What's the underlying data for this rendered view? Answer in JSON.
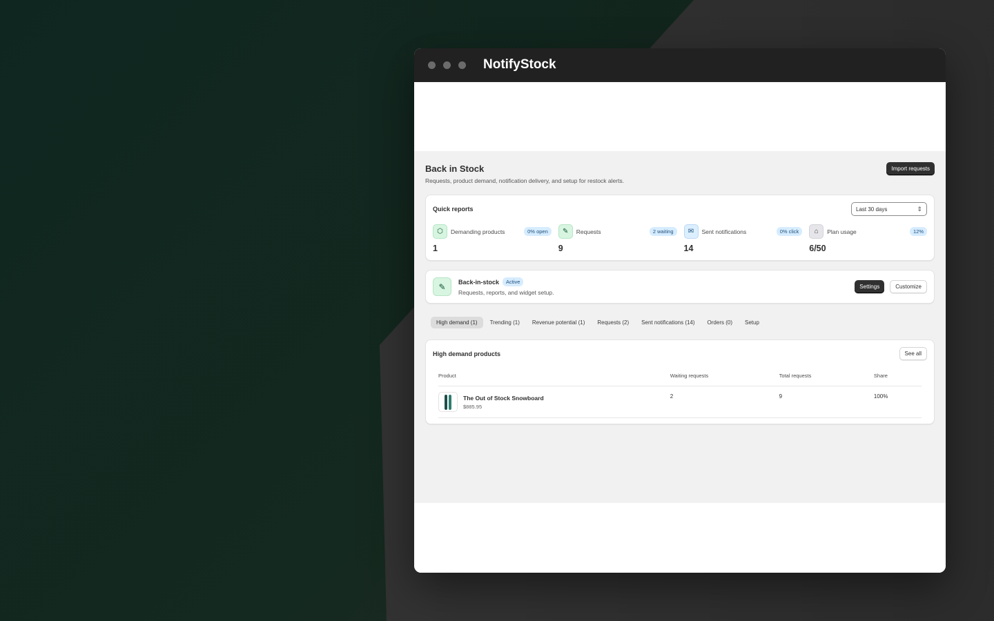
{
  "app": {
    "title": "NotifyStock"
  },
  "page": {
    "title": "Back in Stock",
    "subtitle": "Requests, product demand, notification delivery, and setup for restock alerts.",
    "import_label": "Import requests"
  },
  "quick_reports": {
    "title": "Quick reports",
    "range": "Last 30 days",
    "stats": [
      {
        "label": "Demanding products",
        "badge": "0% open",
        "value": "1",
        "icon": "cube-icon"
      },
      {
        "label": "Requests",
        "badge": "2 waiting",
        "value": "9",
        "icon": "bell-icon"
      },
      {
        "label": "Sent notifications",
        "badge": "0% click",
        "value": "14",
        "icon": "mail-icon"
      },
      {
        "label": "Plan usage",
        "badge": "12%",
        "value": "6/50",
        "icon": "bank-icon"
      }
    ]
  },
  "back_in_stock": {
    "title": "Back-in-stock",
    "status": "Active",
    "subtitle": "Requests, reports, and widget setup.",
    "settings_label": "Settings",
    "customize_label": "Customize"
  },
  "tabs": [
    {
      "label": "High demand (1)",
      "active": true
    },
    {
      "label": "Trending (1)"
    },
    {
      "label": "Revenue potential (1)"
    },
    {
      "label": "Requests (2)"
    },
    {
      "label": "Sent notifications (14)"
    },
    {
      "label": "Orders (0)"
    },
    {
      "label": "Setup"
    }
  ],
  "high_demand": {
    "title": "High demand products",
    "see_all_label": "See all",
    "columns": [
      "Product",
      "Waiting requests",
      "Total requests",
      "Share"
    ],
    "rows": [
      {
        "name": "The Out of Stock Snowboard",
        "price": "$885.95",
        "waiting": "2",
        "total": "9",
        "share": "100%"
      }
    ]
  },
  "colors": {
    "accent_dark": "#303030",
    "badge_blue": "#d6ecff",
    "icon_green": "#d7f5e0",
    "background_green": "#0f2620"
  }
}
